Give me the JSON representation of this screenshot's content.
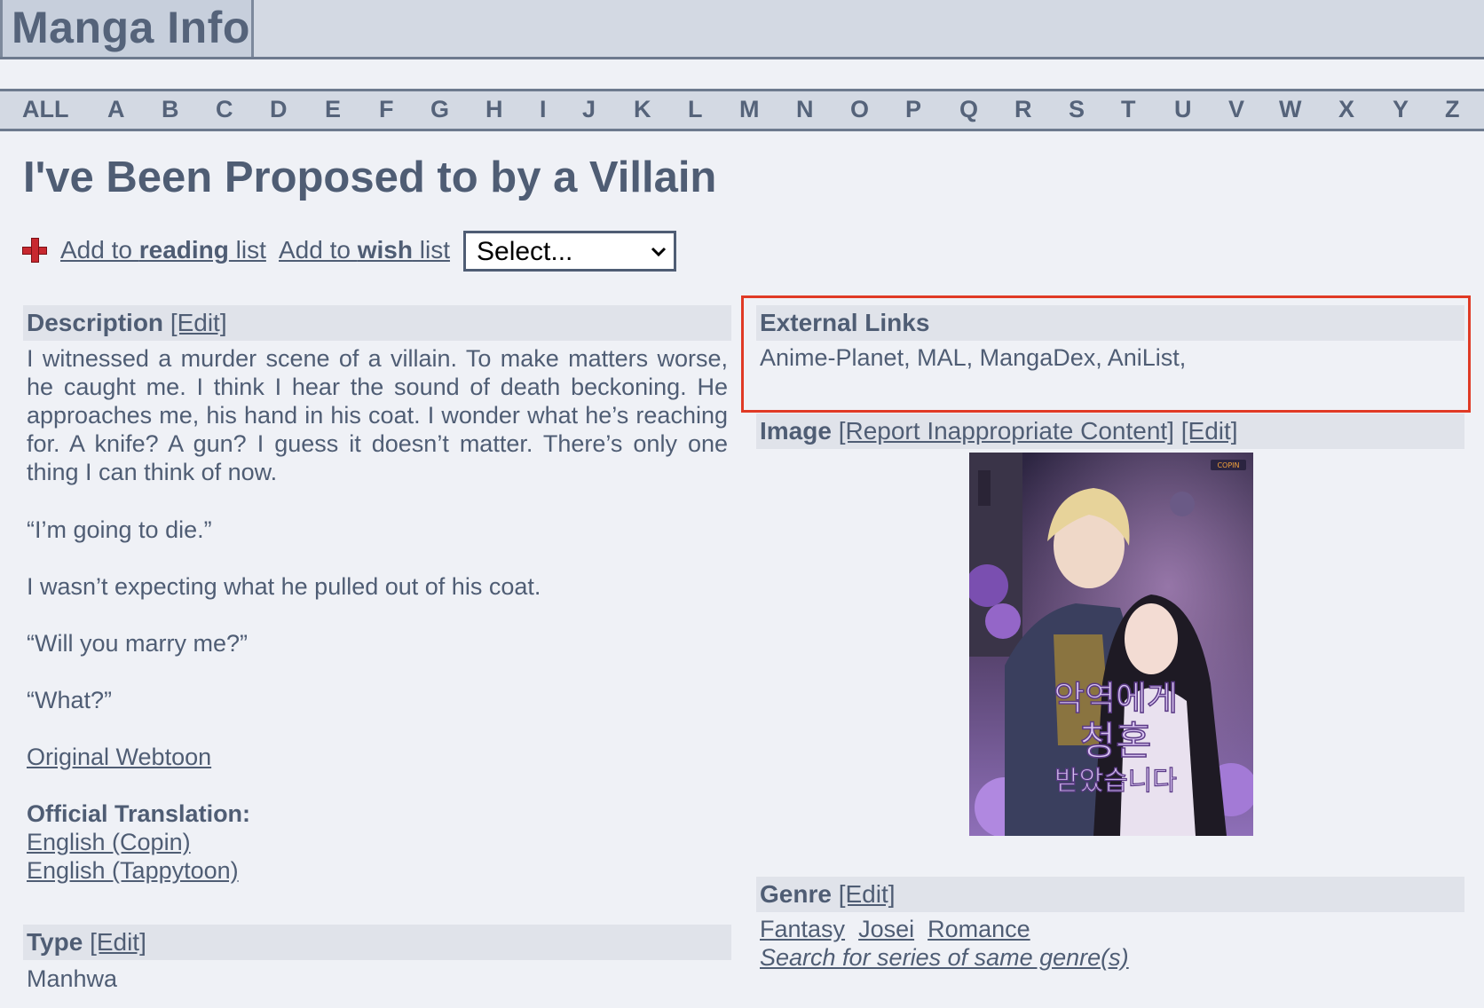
{
  "site": {
    "title": "Manga Info"
  },
  "alphabet": [
    "ALL",
    "A",
    "B",
    "C",
    "D",
    "E",
    "F",
    "G",
    "H",
    "I",
    "J",
    "K",
    "L",
    "M",
    "N",
    "O",
    "P",
    "Q",
    "R",
    "S",
    "T",
    "U",
    "V",
    "W",
    "X",
    "Y",
    "Z"
  ],
  "series": {
    "title": "I've Been Proposed to by a Villain"
  },
  "actions": {
    "reading": {
      "prefix": "Add to ",
      "bold": "reading",
      "suffix": " list"
    },
    "wish": {
      "prefix": "Add to ",
      "bold": "wish",
      "suffix": " list"
    },
    "select_value": "Select..."
  },
  "description": {
    "heading": "Description",
    "edit": "[Edit]",
    "paragraph": "I witnessed a murder scene of a villain. To make matters worse, he caught me. I think I hear the sound of death beckoning. He approaches me, his hand in his coat. I wonder what he’s reaching for. A knife? A gun? I guess it doesn’t matter. There’s only one thing I can think of now.",
    "quote1": "“I’m going to die.”",
    "line2": "I wasn’t expecting what he pulled out of his coat.",
    "quote2": "“Will you marry me?”",
    "quote3": "“What?”",
    "original_link": "Original Webtoon",
    "official_label": "Official Translation:",
    "translations": [
      "English (Copin)",
      "English (Tappytoon)"
    ]
  },
  "type": {
    "heading": "Type",
    "edit": "[Edit]",
    "value": "Manhwa"
  },
  "external": {
    "heading": "External Links",
    "links": [
      "Anime-Planet",
      "MAL",
      "MangaDex",
      "AniList"
    ]
  },
  "image": {
    "heading": "Image",
    "report": "[Report Inappropriate Content]",
    "edit": "[Edit]",
    "cover_title_lines": [
      "악역에게",
      "청혼",
      "받았습니다"
    ],
    "publisher_badge": "COPIN"
  },
  "genre": {
    "heading": "Genre",
    "edit": "[Edit]",
    "items": [
      "Fantasy",
      "Josei",
      "Romance"
    ],
    "search": "Search for series of same genre(s)"
  }
}
